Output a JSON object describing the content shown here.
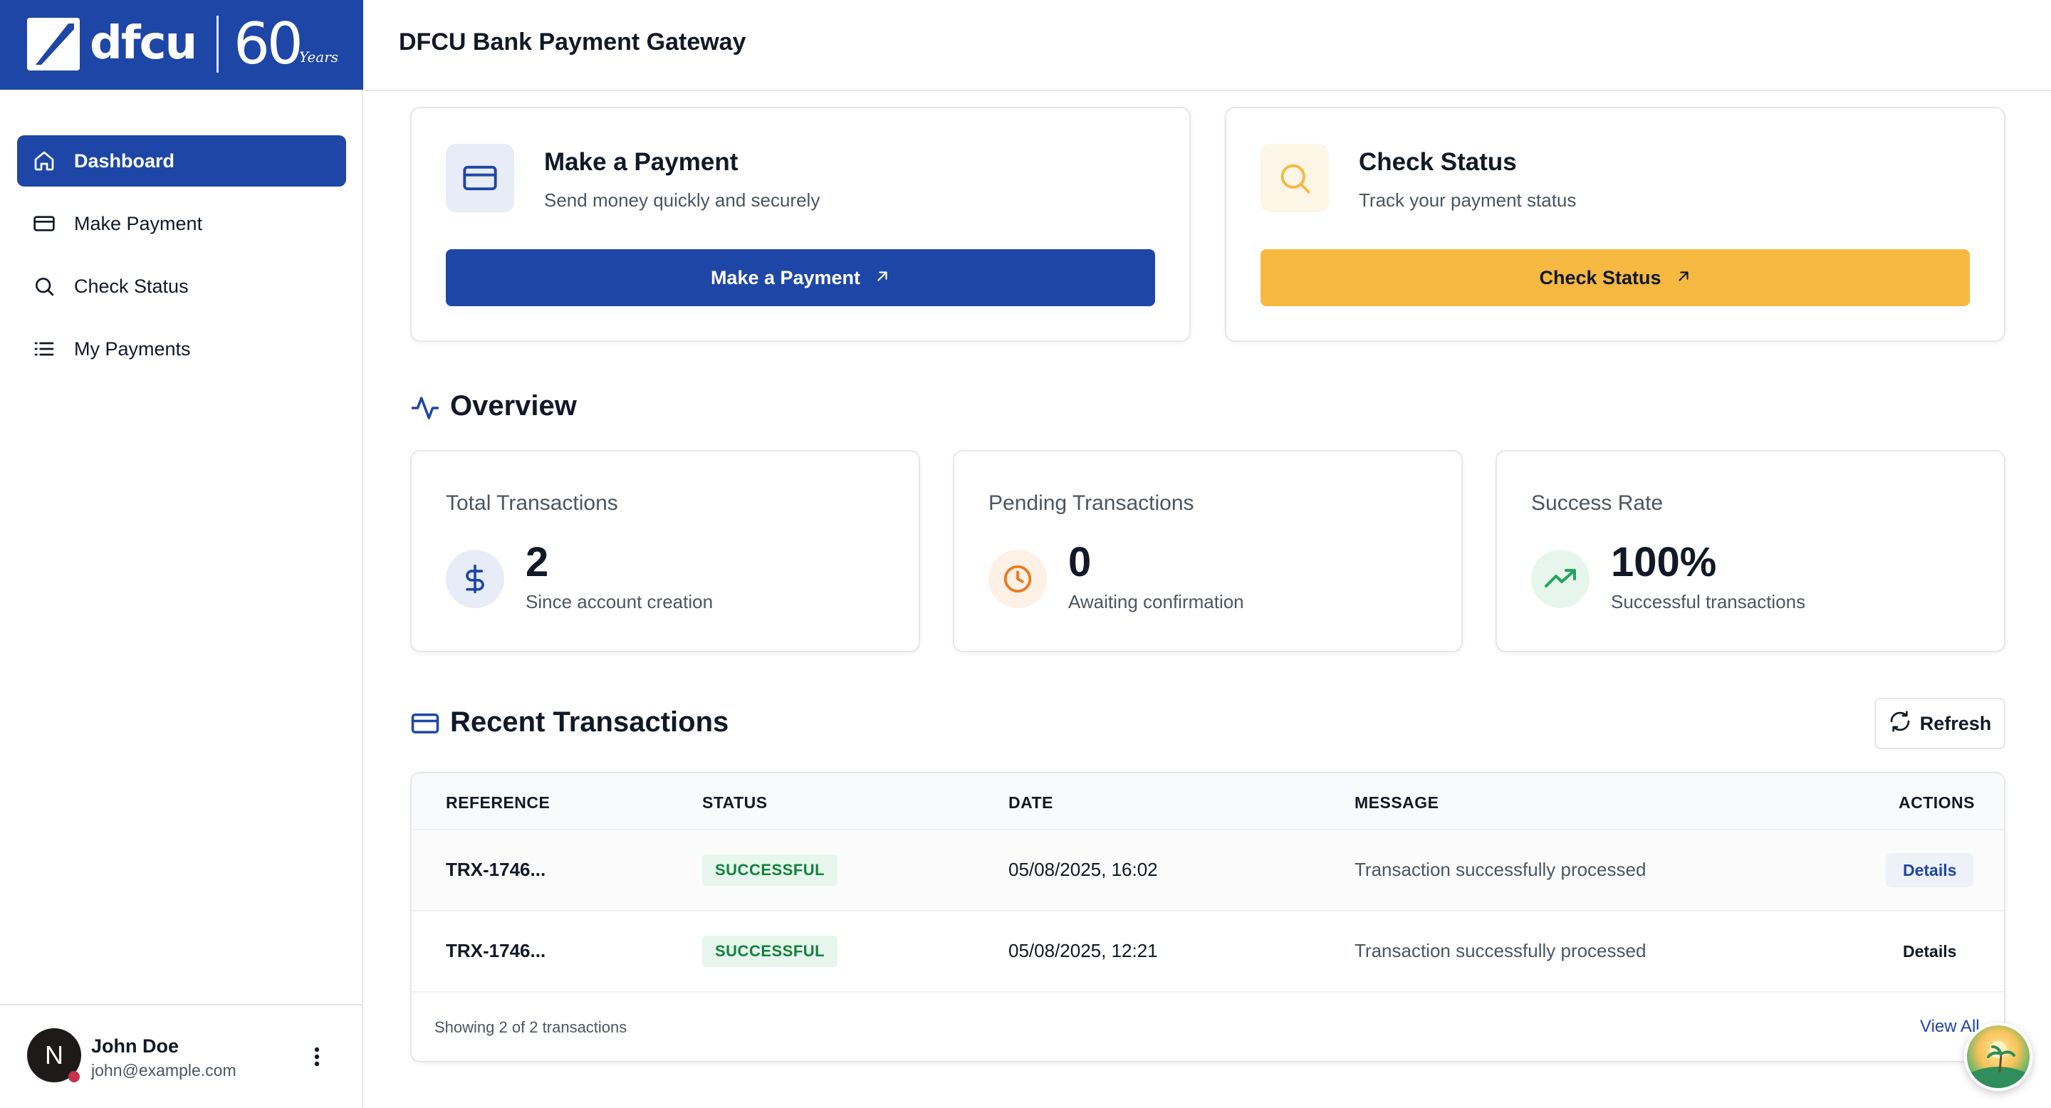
{
  "brand": {
    "logo_text": "dfcu",
    "anniversary_number": "60",
    "anniversary_word": "Years",
    "primary_color": "#1e46a6",
    "accent_color": "#f5b942"
  },
  "header": {
    "title": "DFCU Bank Payment Gateway"
  },
  "sidebar": {
    "items": [
      {
        "label": "Dashboard",
        "icon": "home-icon",
        "active": true
      },
      {
        "label": "Make Payment",
        "icon": "credit-card-icon",
        "active": false
      },
      {
        "label": "Check Status",
        "icon": "search-icon",
        "active": false
      },
      {
        "label": "My Payments",
        "icon": "list-icon",
        "active": false
      }
    ]
  },
  "user": {
    "initial": "N",
    "name": "John Doe",
    "email": "john@example.com"
  },
  "actions": {
    "payment": {
      "title": "Make a Payment",
      "subtitle": "Send money quickly and securely",
      "button": "Make a Payment",
      "icon": "credit-card-icon"
    },
    "status": {
      "title": "Check Status",
      "subtitle": "Track your payment status",
      "button": "Check Status",
      "icon": "search-icon"
    }
  },
  "overview": {
    "title": "Overview",
    "icon": "activity-icon",
    "stats": [
      {
        "label": "Total Transactions",
        "value": "2",
        "sub": "Since account creation",
        "icon": "dollar-icon"
      },
      {
        "label": "Pending Transactions",
        "value": "0",
        "sub": "Awaiting confirmation",
        "icon": "clock-icon"
      },
      {
        "label": "Success Rate",
        "value": "100%",
        "sub": "Successful transactions",
        "icon": "trending-up-icon"
      }
    ]
  },
  "recent": {
    "title": "Recent Transactions",
    "refresh_label": "Refresh",
    "columns": [
      "REFERENCE",
      "STATUS",
      "DATE",
      "MESSAGE",
      "ACTIONS"
    ],
    "rows": [
      {
        "reference": "TRX-1746...",
        "status": "SUCCESSFUL",
        "date": "05/08/2025, 16:02",
        "message": "Transaction successfully processed",
        "action": "Details"
      },
      {
        "reference": "TRX-1746...",
        "status": "SUCCESSFUL",
        "date": "05/08/2025, 12:21",
        "message": "Transaction successfully processed",
        "action": "Details"
      }
    ],
    "footer_text": "Showing 2 of 2 transactions",
    "view_all": "View All"
  }
}
